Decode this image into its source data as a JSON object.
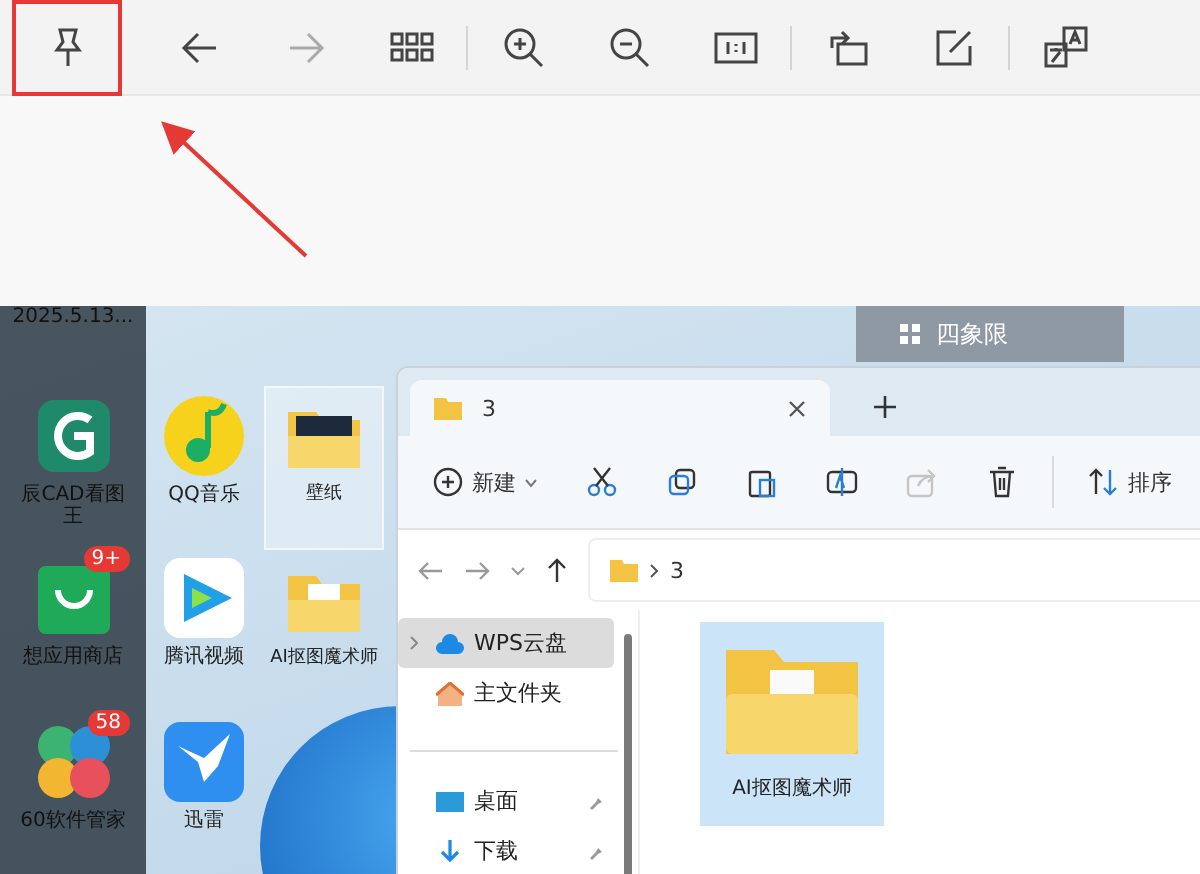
{
  "toolbar": {
    "items": [
      {
        "kind": "pin",
        "highlighted": true,
        "disabled": false
      },
      {
        "kind": "back",
        "highlighted": false,
        "disabled": false
      },
      {
        "kind": "forward",
        "highlighted": false,
        "disabled": true
      },
      {
        "kind": "grid",
        "highlighted": false,
        "disabled": false
      },
      {
        "kind": "divider"
      },
      {
        "kind": "zoom-in",
        "highlighted": false,
        "disabled": false
      },
      {
        "kind": "zoom-out",
        "highlighted": false,
        "disabled": false
      },
      {
        "kind": "actual-size",
        "highlighted": false,
        "disabled": false
      },
      {
        "kind": "divider"
      },
      {
        "kind": "rotate",
        "highlighted": false,
        "disabled": false
      },
      {
        "kind": "edit",
        "highlighted": false,
        "disabled": false
      },
      {
        "kind": "divider"
      },
      {
        "kind": "translate",
        "highlighted": false,
        "disabled": false
      }
    ]
  },
  "screenshot": {
    "widget": {
      "label": "四象限"
    },
    "desktop": {
      "columns": [
        {
          "dimmed": true,
          "top_label": "2025.5.13...",
          "icons": [
            {
              "kind": "cad",
              "label": "辰CAD看图王",
              "selected": false
            },
            {
              "kind": "store",
              "label": "想应用商店",
              "selected": false,
              "badge": "9+"
            },
            {
              "kind": "clover",
              "label": "60软件管家",
              "selected": false,
              "badge": "58"
            }
          ]
        },
        {
          "dimmed": false,
          "icons": [
            {
              "kind": "music",
              "label": "QQ音乐",
              "selected": false
            },
            {
              "kind": "video",
              "label": "腾讯视频",
              "selected": false
            },
            {
              "kind": "bird",
              "label": "迅雷",
              "selected": false
            }
          ]
        },
        {
          "dimmed": false,
          "icons": [
            {
              "kind": "photo-folder",
              "label": "壁纸",
              "selected": true
            },
            {
              "kind": "folder",
              "label": "AI抠图魔术师",
              "selected": false
            }
          ]
        }
      ]
    },
    "explorer": {
      "tabs": [
        {
          "label": "3",
          "selected": true
        }
      ],
      "actions": [
        {
          "kind": "new",
          "label": "新建",
          "disabled": false
        },
        {
          "kind": "cut",
          "disabled": false
        },
        {
          "kind": "copy",
          "disabled": false
        },
        {
          "kind": "paste",
          "disabled": false
        },
        {
          "kind": "rename",
          "disabled": false
        },
        {
          "kind": "share",
          "disabled": true
        },
        {
          "kind": "delete",
          "disabled": false
        },
        {
          "kind": "sort",
          "label": "排序",
          "disabled": false
        }
      ],
      "address": "3",
      "nav": [
        {
          "kind": "cloud",
          "label": "WPS云盘",
          "selected": true,
          "pinned": false
        },
        {
          "kind": "home",
          "label": "主文件夹",
          "selected": false,
          "pinned": false
        },
        {
          "kind": "desktop",
          "label": "桌面",
          "selected": false,
          "pinned": true
        },
        {
          "kind": "download",
          "label": "下载",
          "selected": false,
          "pinned": true
        }
      ],
      "files": [
        {
          "label": "AI抠图魔术师",
          "selected": true
        }
      ]
    }
  }
}
